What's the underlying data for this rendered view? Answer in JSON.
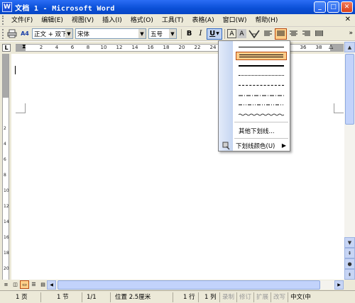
{
  "window": {
    "icon_letter": "W",
    "title": "文档 1 - Microsoft Word",
    "btn_min": "_",
    "btn_max": "□",
    "btn_close": "✕"
  },
  "menubar": {
    "items": [
      "文件(F)",
      "编辑(E)",
      "视图(V)",
      "插入(I)",
      "格式(O)",
      "工具(T)",
      "表格(A)",
      "窗口(W)",
      "帮助(H)"
    ],
    "doc_close": "✕"
  },
  "toolbar": {
    "style_icon": "A4",
    "style_value": "正文 + 双下",
    "font_value": "宋体",
    "size_value": "五号",
    "bold": "B",
    "italic": "I",
    "underline": "U",
    "border_char": "A",
    "shade_char": "A",
    "expand": "»"
  },
  "ruler": {
    "corner": "L",
    "numbers": [
      "2",
      "4",
      "6",
      "8",
      "10",
      "12",
      "14",
      "16",
      "18",
      "20",
      "22",
      "24",
      "36",
      "38"
    ],
    "vertical_numbers": [
      "2",
      "4",
      "6",
      "8",
      "10",
      "12",
      "14",
      "16",
      "18",
      "20"
    ]
  },
  "underline_menu": {
    "more_underlines": "其他下划线...",
    "underline_color": "下划线颜色(U)",
    "arrow": "▶"
  },
  "statusbar": {
    "page": "1 页",
    "section": "1 节",
    "page_of": "1/1",
    "position": "位置 2.5厘米",
    "line": "1 行",
    "column": "1 列",
    "rec": "录制",
    "trk": "修订",
    "ext": "扩展",
    "ovr": "改写",
    "lang": "中文(中"
  },
  "colors": {
    "titlebar": "#0a4fd6",
    "chrome": "#ece9d8",
    "selected": "#ffcc88"
  }
}
